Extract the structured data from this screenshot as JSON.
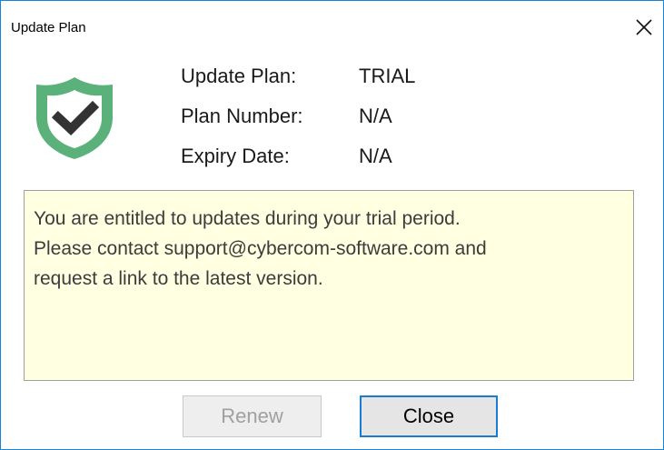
{
  "window": {
    "title": "Update Plan",
    "close_icon": "close-icon"
  },
  "plan": {
    "icon": "shield-check-icon",
    "icon_colors": {
      "shield": "#5ab27a",
      "check": "#333333"
    },
    "rows": [
      {
        "label": "Update Plan:",
        "value": "TRIAL"
      },
      {
        "label": "Plan Number:",
        "value": "N/A"
      },
      {
        "label": "Expiry Date:",
        "value": "N/A"
      }
    ]
  },
  "notice": {
    "lines": [
      "You are entitled to updates during your trial period.",
      "Please contact support@cybercom-software.com and",
      "request a link to the latest version."
    ],
    "background": "#ffffe1"
  },
  "buttons": {
    "renew_label": "Renew",
    "renew_enabled": false,
    "close_label": "Close"
  },
  "colors": {
    "window_border": "#1883d7",
    "focus_border": "#1a7bd4"
  }
}
